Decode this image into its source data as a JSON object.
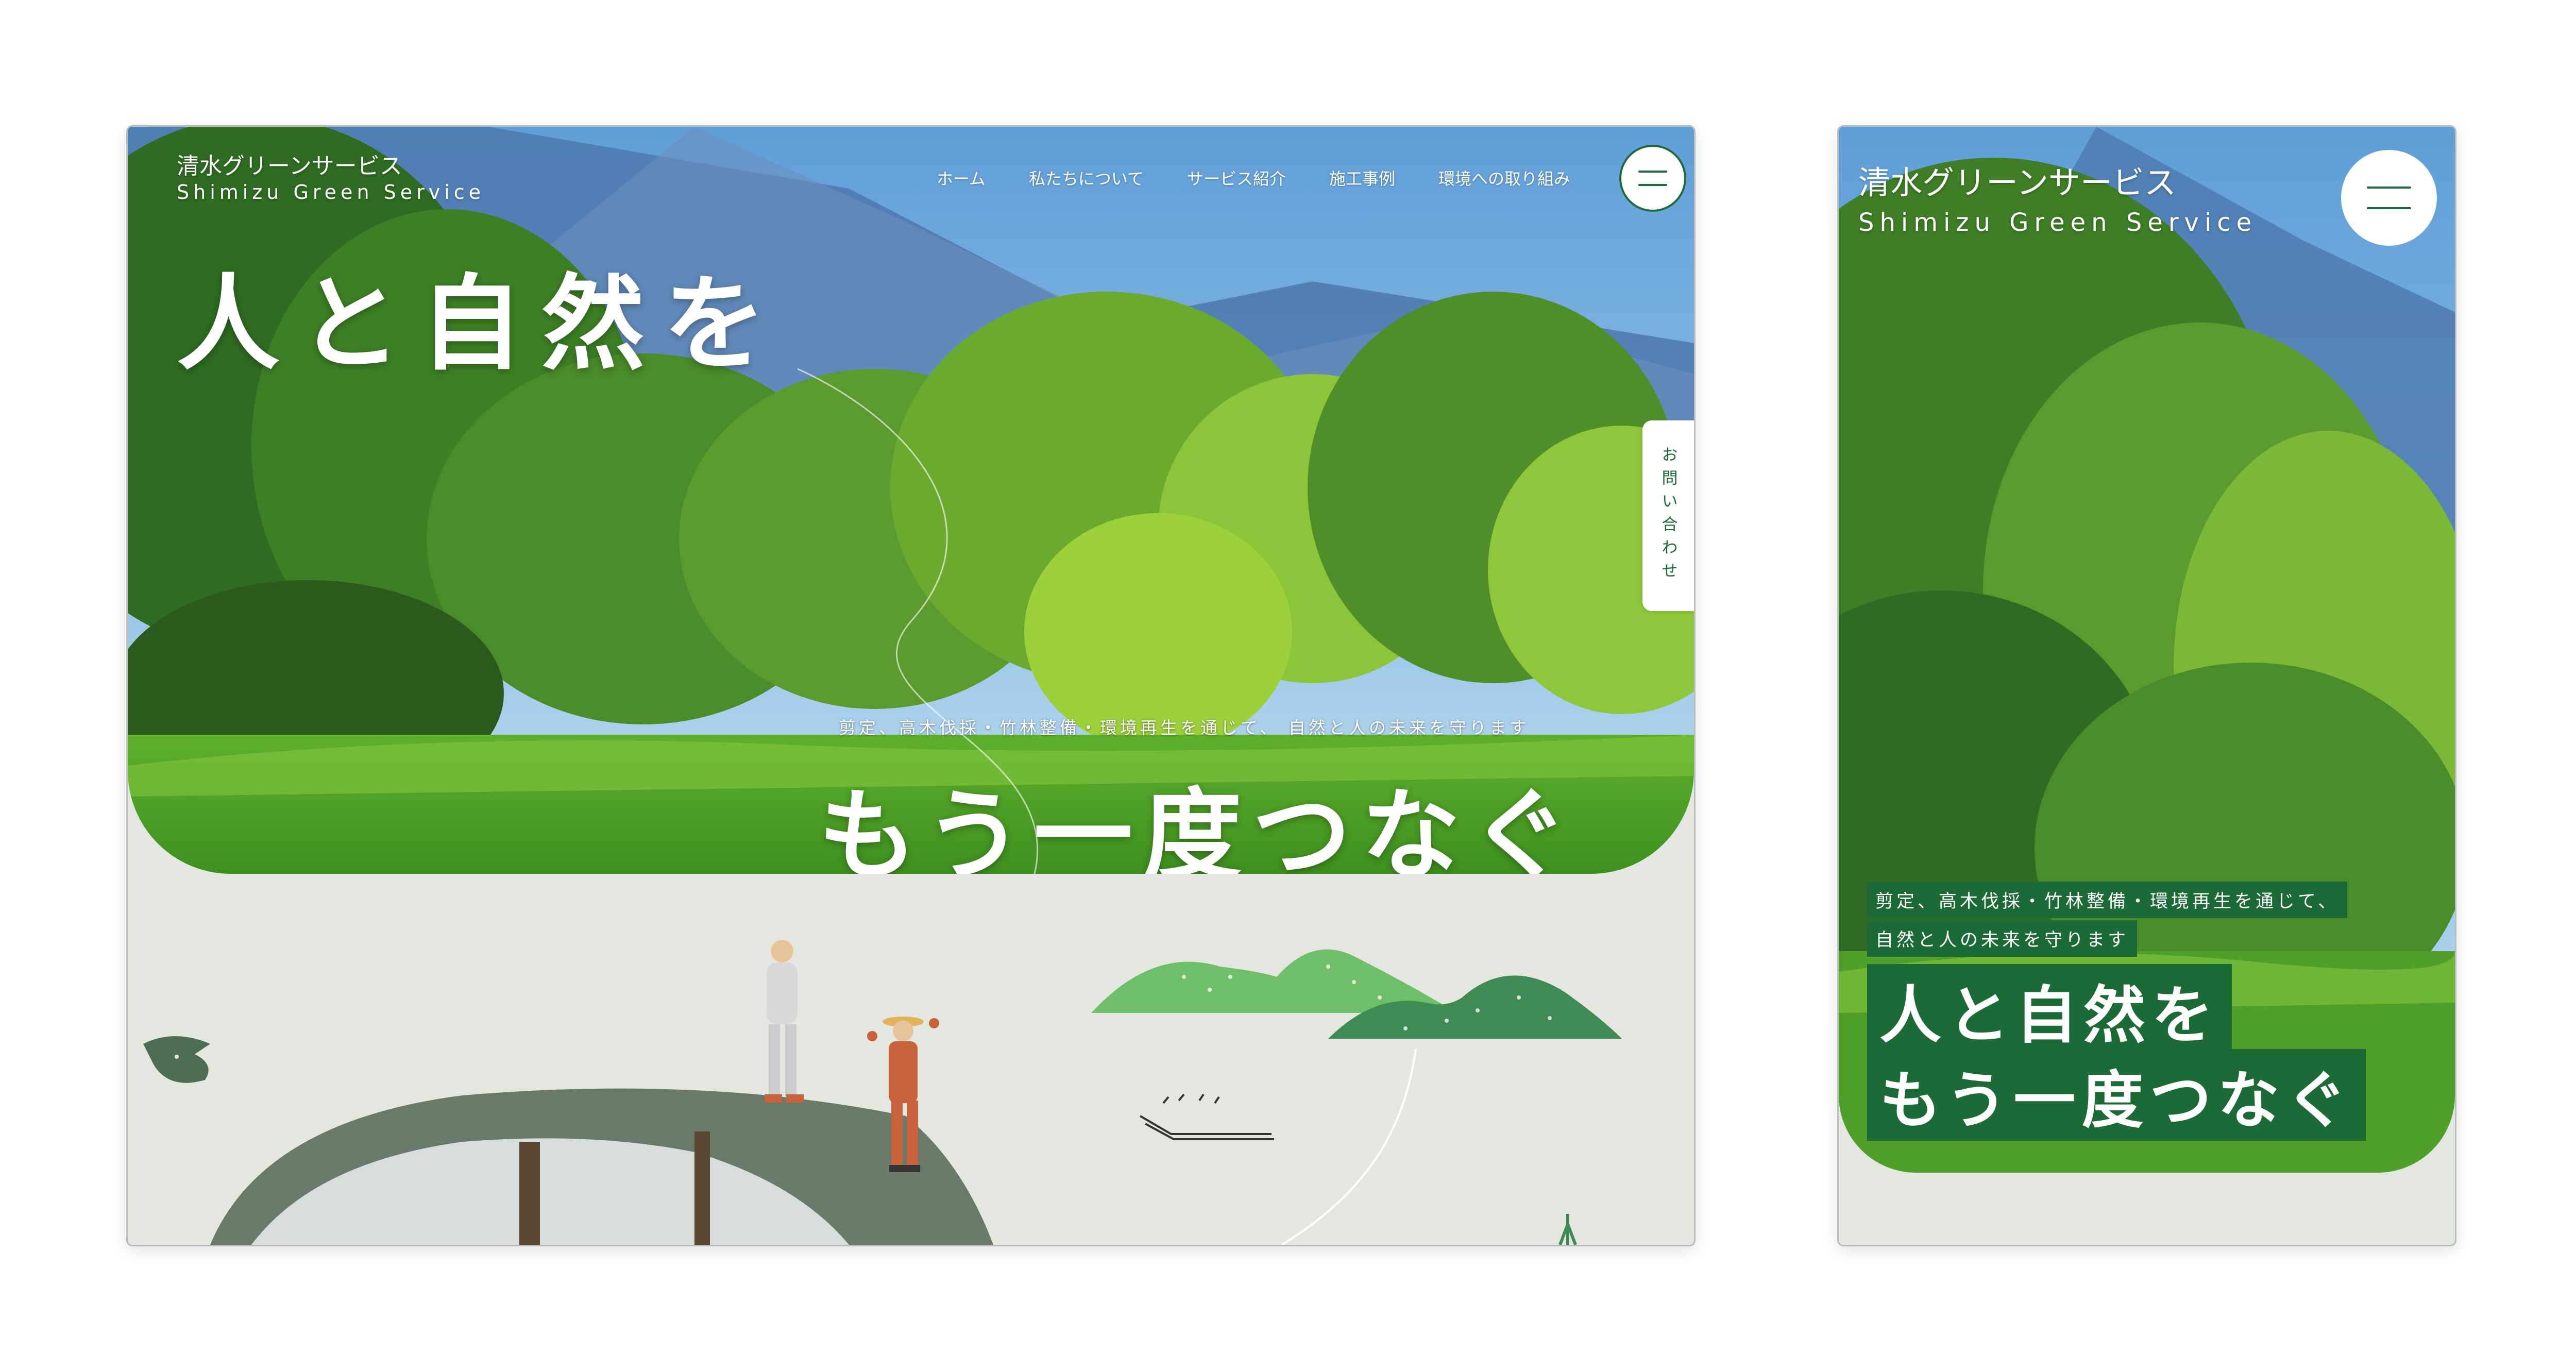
{
  "brand": {
    "name_jp": "清水グリーンサービス",
    "name_en": "Shimizu Green Service"
  },
  "nav": {
    "items": [
      {
        "label": "ホーム"
      },
      {
        "label": "私たちについて"
      },
      {
        "label": "サービス紹介"
      },
      {
        "label": "施工事例"
      },
      {
        "label": "環境への取り組み"
      }
    ]
  },
  "contact_tab": {
    "label": "お問い合わせ"
  },
  "hero": {
    "headline_1": "人と自然を",
    "headline_2": "もう一度つなぐ",
    "tagline": "剪定、高木伐採・竹林整備・環境再生を通じて、 自然と人の未来を守ります",
    "tagline_line_1": "剪定、高木伐採・竹林整備・環境再生を通じて、",
    "tagline_line_2": "自然と人の未来を守ります"
  },
  "colors": {
    "brand_green": "#1d6b3a",
    "section_bg": "#e3e7e0",
    "mountain_light": "#6fbf6a",
    "mountain_dark": "#3f8b53",
    "overalls": "#c8623c"
  },
  "icons": {
    "menu": "hamburger-icon",
    "bird": "bird-icon"
  }
}
